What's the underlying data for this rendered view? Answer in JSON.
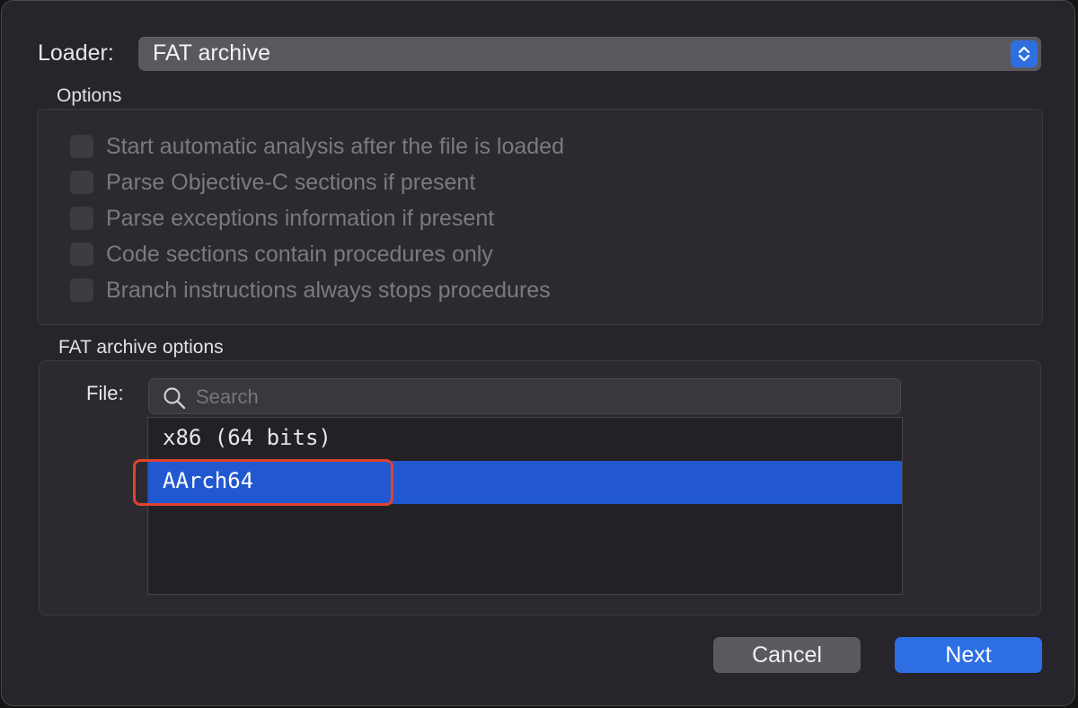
{
  "loader": {
    "label": "Loader:",
    "selected": "FAT archive"
  },
  "options": {
    "title": "Options",
    "items": [
      {
        "label": "Start automatic analysis after the file is loaded",
        "checked": false,
        "enabled": false
      },
      {
        "label": "Parse Objective-C sections if present",
        "checked": false,
        "enabled": false
      },
      {
        "label": "Parse exceptions information if present",
        "checked": false,
        "enabled": false
      },
      {
        "label": "Code sections contain procedures only",
        "checked": false,
        "enabled": false
      },
      {
        "label": "Branch instructions always stops procedures",
        "checked": false,
        "enabled": false
      }
    ]
  },
  "fat_options": {
    "title": "FAT archive options",
    "file_label": "File:",
    "search_placeholder": "Search",
    "search_value": "",
    "files": [
      "x86 (64 bits)",
      "AArch64"
    ],
    "selected_index": 1
  },
  "buttons": {
    "cancel": "Cancel",
    "next": "Next"
  },
  "colors": {
    "accent": "#2d6fe3",
    "selection": "#2258cf",
    "highlight_outline": "#e0432d"
  }
}
